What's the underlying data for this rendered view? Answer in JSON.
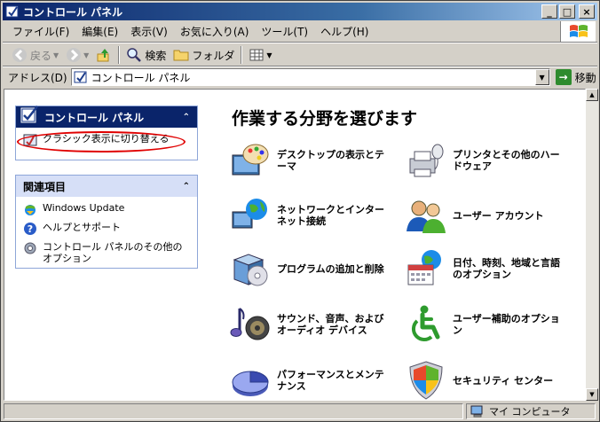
{
  "window": {
    "title": "コントロール パネル"
  },
  "menu": [
    "ファイル(F)",
    "編集(E)",
    "表示(V)",
    "お気に入り(A)",
    "ツール(T)",
    "ヘルプ(H)"
  ],
  "toolbar": {
    "back": "戻る",
    "search": "検索",
    "folder": "フォルダ"
  },
  "address": {
    "label": "アドレス(D)",
    "value": "コントロール パネル",
    "go": "移動"
  },
  "panel1": {
    "title": "コントロール パネル",
    "link": "クラシック表示に切り替える"
  },
  "panel2": {
    "title": "関連項目",
    "links": [
      "Windows Update",
      "ヘルプとサポート",
      "コントロール パネルのその他のオプション"
    ]
  },
  "main": {
    "title": "作業する分野を選びます",
    "categories": [
      "デスクトップの表示とテーマ",
      "プリンタとその他のハードウェア",
      "ネットワークとインターネット接続",
      "ユーザー アカウント",
      "プログラムの追加と削除",
      "日付、時刻、地域と言語のオプション",
      "サウンド、音声、およびオーディオ デバイス",
      "ユーザー補助のオプション",
      "パフォーマンスとメンテナンス",
      "セキュリティ センター"
    ]
  },
  "status": {
    "computer": "マイ コンピュータ"
  },
  "colors": {
    "titlebar": "#0a246a",
    "panel_head": "#0a246a",
    "panel_head2": "#d6dff7",
    "highlight": "#e00000"
  }
}
